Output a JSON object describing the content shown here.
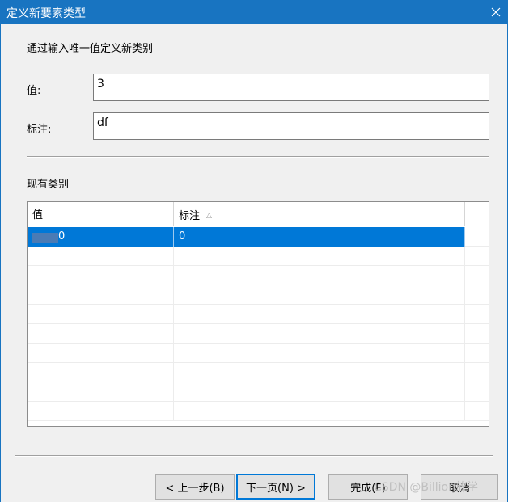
{
  "window": {
    "title": "定义新要素类型"
  },
  "form": {
    "intro": "通过输入唯一值定义新类别",
    "value_label": "值:",
    "value": "3",
    "note_label": "标注:",
    "note": "df"
  },
  "existing": {
    "title": "现有类别",
    "columns": [
      "值",
      "标注"
    ],
    "sort_indicator": "△",
    "rows": [
      {
        "value": "0",
        "note": "0"
      }
    ]
  },
  "buttons": {
    "back": "< 上一步(B)",
    "next": "下一页(N) >",
    "finish": "完成(F)",
    "cancel": "取消"
  },
  "watermark": "CSDN @Billion放学"
}
